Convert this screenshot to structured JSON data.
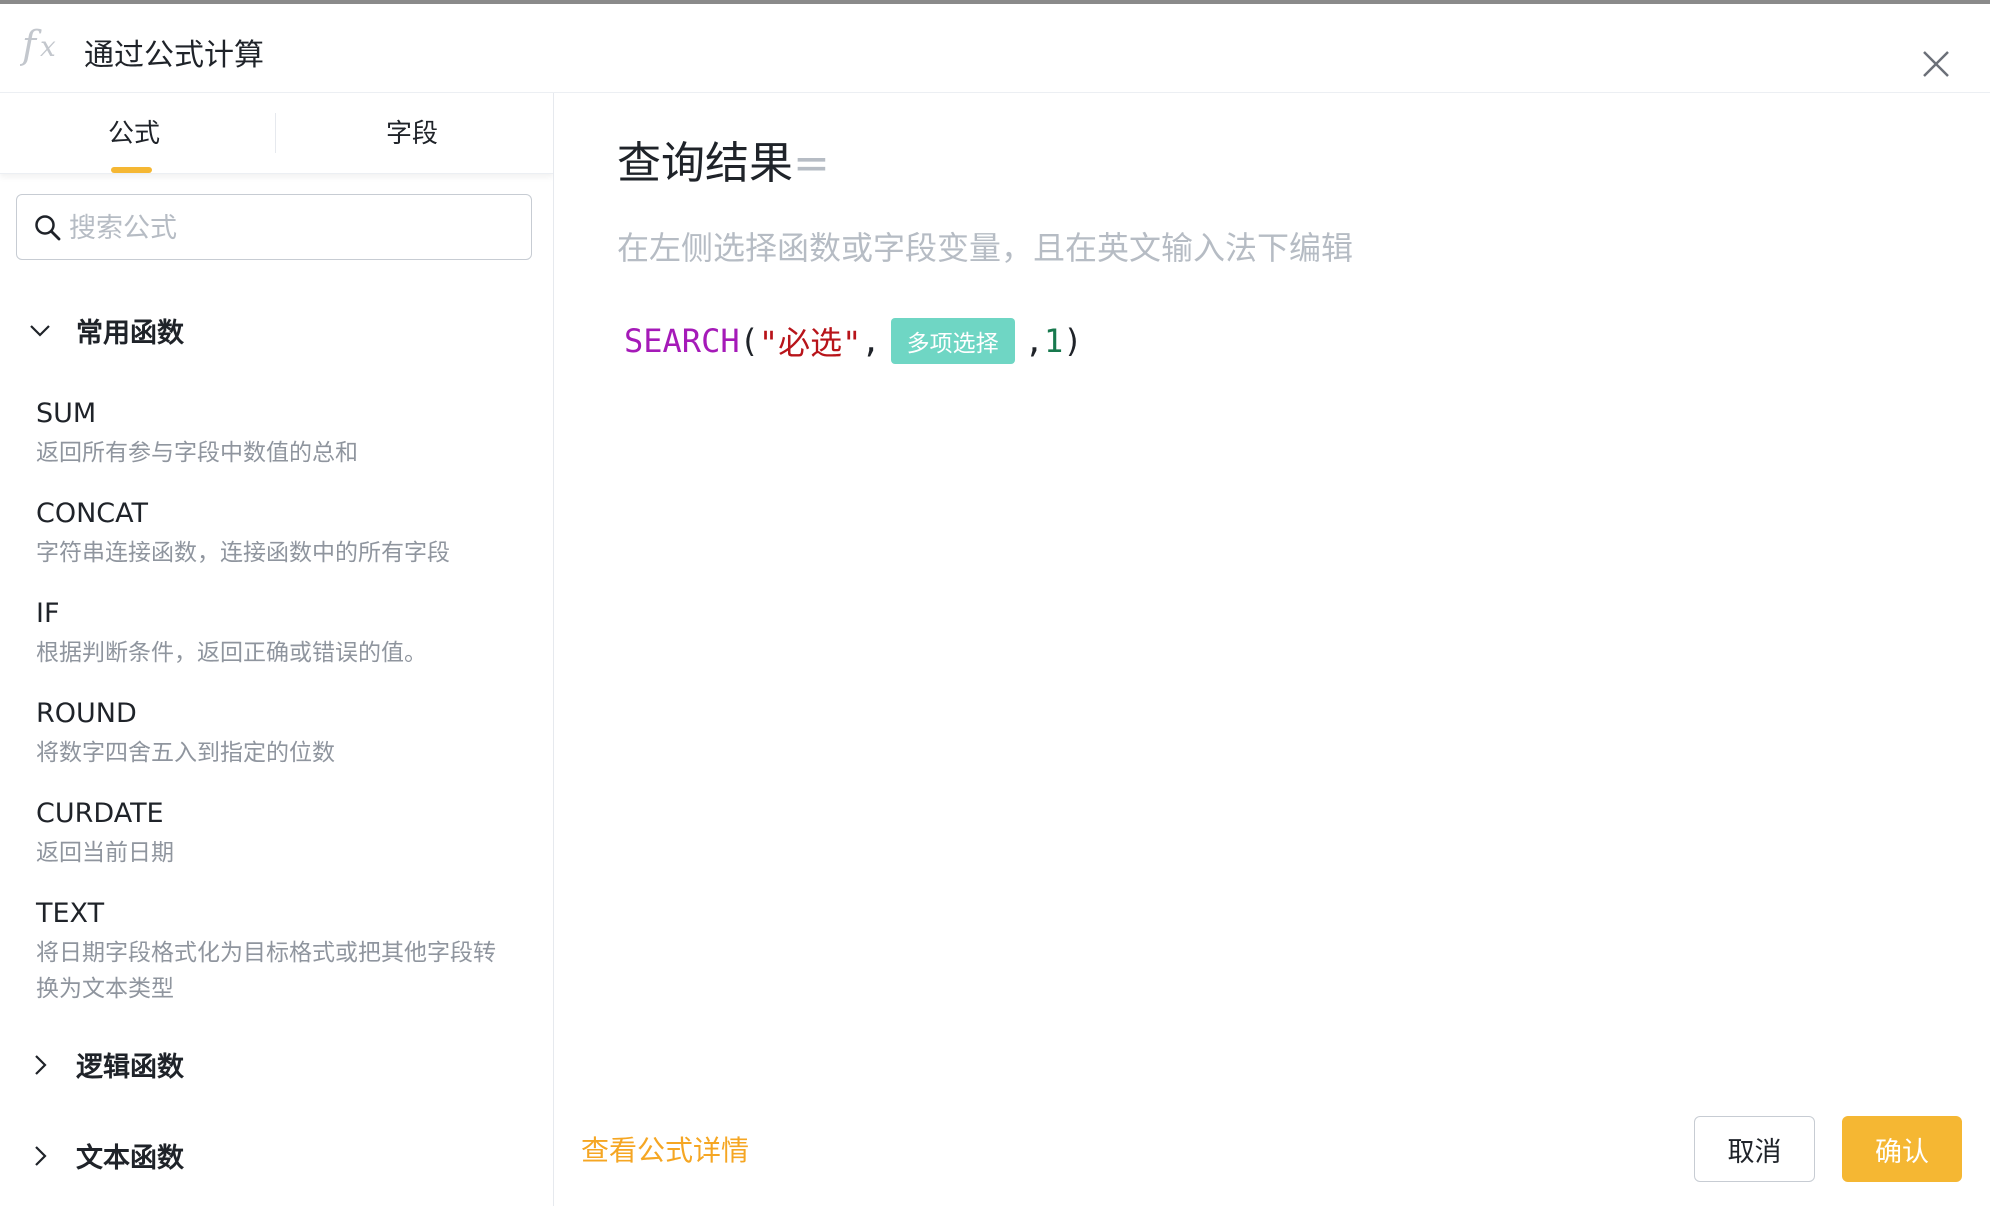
{
  "dialog": {
    "title": "通过公式计算",
    "icon": "fx-icon",
    "close_icon": "close-icon"
  },
  "sidebar": {
    "tabs": [
      {
        "label": "公式",
        "active": true
      },
      {
        "label": "字段",
        "active": false
      }
    ],
    "search": {
      "placeholder": "搜索公式",
      "value": ""
    },
    "categories": [
      {
        "label": "常用函数",
        "expanded": true,
        "functions": [
          {
            "name": "SUM",
            "desc": "返回所有参与字段中数值的总和"
          },
          {
            "name": "CONCAT",
            "desc": "字符串连接函数，连接函数中的所有字段"
          },
          {
            "name": "IF",
            "desc": "根据判断条件，返回正确或错误的值。"
          },
          {
            "name": "ROUND",
            "desc": "将数字四舍五入到指定的位数"
          },
          {
            "name": "CURDATE",
            "desc": "返回当前日期"
          },
          {
            "name": "TEXT",
            "desc": "将日期字段格式化为目标格式或把其他字段转换为文本类型"
          }
        ]
      },
      {
        "label": "逻辑函数",
        "expanded": false
      },
      {
        "label": "文本函数",
        "expanded": false
      }
    ]
  },
  "main": {
    "result_label": "查询结果",
    "equals": "=",
    "hint": "在左侧选择函数或字段变量，且在英文输入法下编辑",
    "formula": {
      "function": "SEARCH",
      "open_paren": "(",
      "string_arg": "\"必选\"",
      "comma1": ",",
      "field_chip": "多项选择",
      "comma2": ",",
      "number_arg": "1",
      "close_paren": ")"
    },
    "details_link": "查看公式详情",
    "cancel_label": "取消",
    "confirm_label": "确认"
  },
  "colors": {
    "accent": "#f5b733",
    "field_chip": "#6fd6c4",
    "function_token": "#a51ab8",
    "string_token": "#b8141a",
    "number_token": "#18794e"
  }
}
